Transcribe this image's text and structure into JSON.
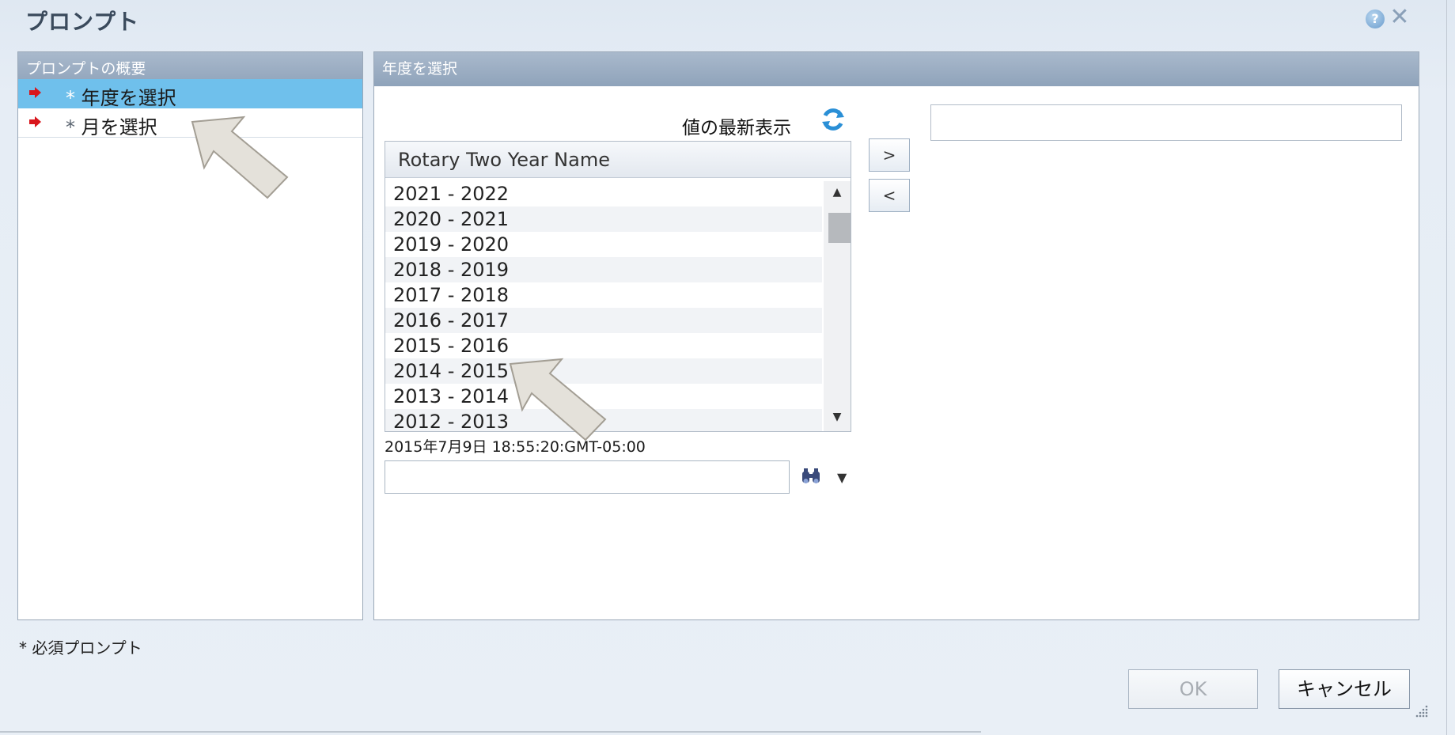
{
  "dialog": {
    "title": "プロンプト",
    "help_icon": "help-icon",
    "close_icon": "close-icon"
  },
  "summary_panel": {
    "header": "プロンプトの概要",
    "items": [
      {
        "star": "*",
        "label": "年度を選択",
        "selected": true,
        "icon": "red-arrow-icon"
      },
      {
        "star": "*",
        "label": "月を選択",
        "selected": false,
        "icon": "red-arrow-icon"
      }
    ]
  },
  "selection_panel": {
    "header": "年度を選択",
    "refresh_label": "値の最新表示",
    "list_header": "Rotary Two Year Name",
    "list_values": [
      "2021 - 2022",
      "2020 - 2021",
      "2019 - 2020",
      "2018 - 2019",
      "2017 - 2018",
      "2016 - 2017",
      "2015 - 2016",
      "2014 - 2015",
      "2013 - 2014",
      "2012 - 2013"
    ],
    "add_button": ">",
    "remove_button": "<",
    "timestamp": "2015年7月9日 18:55:20:GMT-05:00",
    "search_value": "",
    "selected_value": ""
  },
  "footer": {
    "required_note": "* 必須プロンプト",
    "ok_label": "OK",
    "cancel_label": "キャンセル"
  },
  "colors": {
    "selected_row": "#6fc0ec",
    "header_bg": "#9aaec4",
    "arrow_red": "#d9161c"
  }
}
